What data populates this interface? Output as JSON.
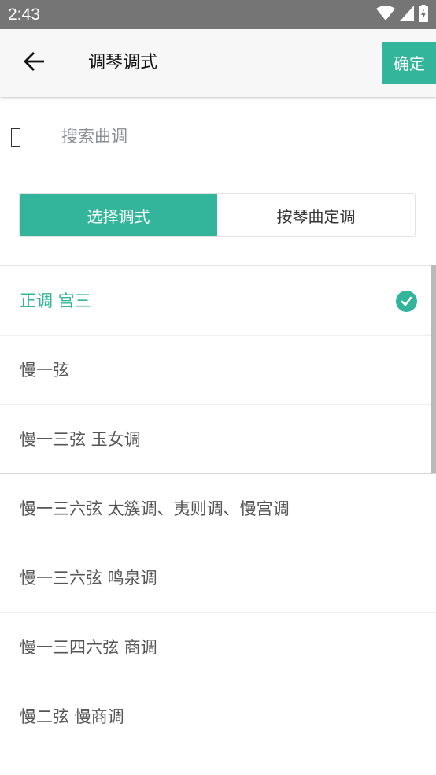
{
  "status_bar": {
    "time": "2:43",
    "icons": [
      "wifi-icon",
      "cell-signal-icon",
      "battery-icon"
    ]
  },
  "app_bar": {
    "title": "调琴调式",
    "confirm_label": "确定",
    "back_icon": "arrow-left-icon"
  },
  "search": {
    "placeholder": "搜索曲调",
    "value": ""
  },
  "segment": {
    "tabs": [
      {
        "label": "选择调式",
        "active": true
      },
      {
        "label": "按琴曲定调",
        "active": false
      }
    ]
  },
  "list": {
    "items": [
      {
        "label": "正调 宫三",
        "selected": true
      },
      {
        "label": "慢一弦",
        "selected": false
      },
      {
        "label": "慢一三弦 玉女调",
        "selected": false
      },
      {
        "label": "慢一三六弦 太簇调、夷则调、慢宫调",
        "selected": false
      },
      {
        "label": "慢一三六弦 鸣泉调",
        "selected": false
      },
      {
        "label": "慢一三四六弦 商调",
        "selected": false
      },
      {
        "label": "慢二弦 慢商调",
        "selected": false
      }
    ]
  },
  "colors": {
    "accent": "#33b59b",
    "status_bar": "#757575",
    "app_bar": "#f7f7f7"
  }
}
